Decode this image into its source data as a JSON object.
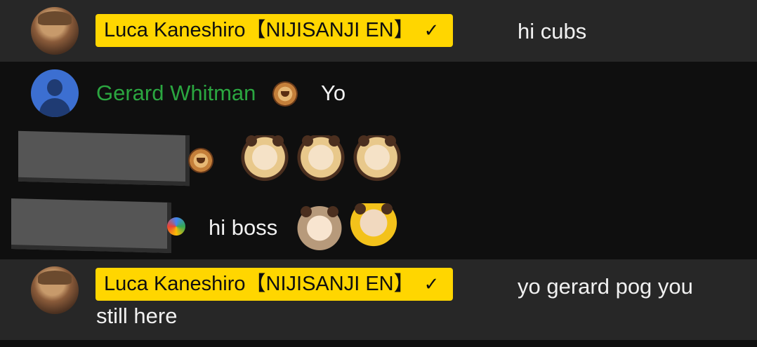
{
  "messages": [
    {
      "author": "Luca Kaneshiro【NIJISANJI EN】",
      "verified_mark": "✓",
      "text": "hi cubs"
    },
    {
      "author": "Gerard Whitman",
      "text": "Yo"
    },
    {
      "author": "",
      "text": ""
    },
    {
      "author": "",
      "text": "hi boss"
    },
    {
      "author": "Luca Kaneshiro【NIJISANJI EN】",
      "verified_mark": "✓",
      "text_line1": "yo gerard pog you",
      "text_line2": "still here"
    }
  ],
  "colors": {
    "owner_badge_bg": "#ffd600",
    "member_name": "#2ba640",
    "background": "#0f0f0f",
    "highlight_row": "#272727"
  },
  "icons": {
    "member_badge": "lion-member-badge-icon",
    "verified": "check-icon",
    "avatar_default": "default-avatar-icon"
  }
}
